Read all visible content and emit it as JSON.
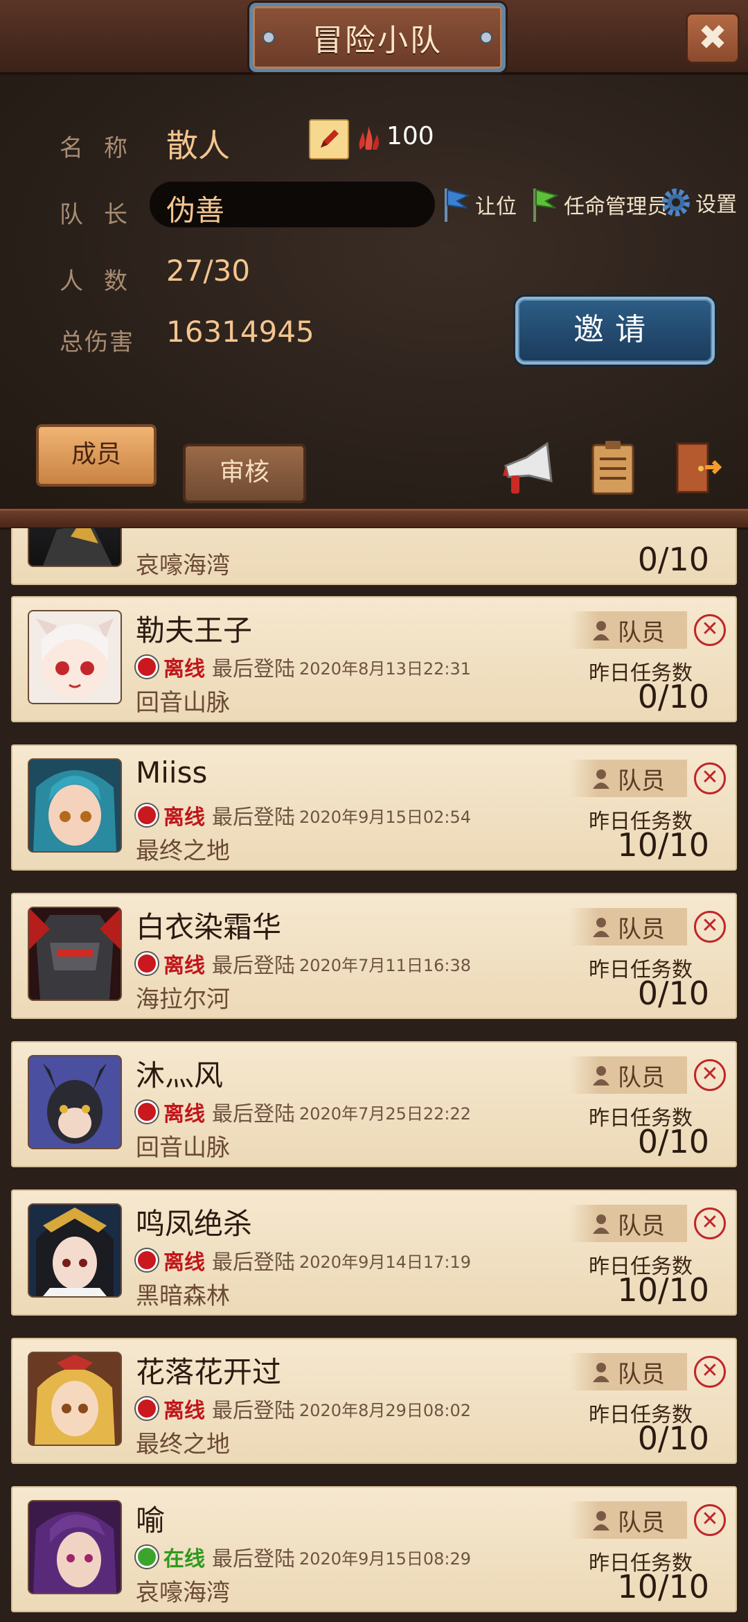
{
  "header": {
    "title": "冒险小队",
    "close_label": "✖"
  },
  "team": {
    "name_label": "名称",
    "name_value": "散人",
    "fire_count": "100",
    "leader_label": "队长",
    "leader_value": "伪善",
    "count_label": "人数",
    "count_value": "27/30",
    "damage_label": "总伤害",
    "damage_value": "16314945"
  },
  "actions": {
    "transfer": "让位",
    "appoint": "任命管理员",
    "settings": "设置",
    "invite": "邀请"
  },
  "tabs": {
    "members": "成员",
    "review": "审核"
  },
  "list_labels": {
    "role": "队员",
    "task": "昨日任务数",
    "last_login": "最后登陆",
    "offline": "离线",
    "online": "在线"
  },
  "colors": {
    "offline": "#c9181e",
    "online": "#3aa52a",
    "accent": "#f4c58f"
  },
  "partial_member": {
    "location": "哀嚎海湾",
    "task_count": "0/10"
  },
  "members": [
    {
      "name": "勒夫王子",
      "status": "离线",
      "last_login": "2020年8月13日22:31",
      "location": "回音山脉",
      "task_count": "0/10"
    },
    {
      "name": "Miiss",
      "status": "离线",
      "last_login": "2020年9月15日02:54",
      "location": "最终之地",
      "task_count": "10/10"
    },
    {
      "name": "白衣染霜华",
      "status": "离线",
      "last_login": "2020年7月11日16:38",
      "location": "海拉尔河",
      "task_count": "0/10"
    },
    {
      "name": "沐灬风",
      "status": "离线",
      "last_login": "2020年7月25日22:22",
      "location": "回音山脉",
      "task_count": "0/10"
    },
    {
      "name": "鸣凤绝杀",
      "status": "离线",
      "last_login": "2020年9月14日17:19",
      "location": "黑暗森林",
      "task_count": "10/10"
    },
    {
      "name": "花落花开过",
      "status": "离线",
      "last_login": "2020年8月29日08:02",
      "location": "最终之地",
      "task_count": "0/10"
    },
    {
      "name": "喻",
      "status": "在线",
      "last_login": "2020年9月15日08:29",
      "location": "哀嚎海湾",
      "task_count": "10/10"
    }
  ]
}
